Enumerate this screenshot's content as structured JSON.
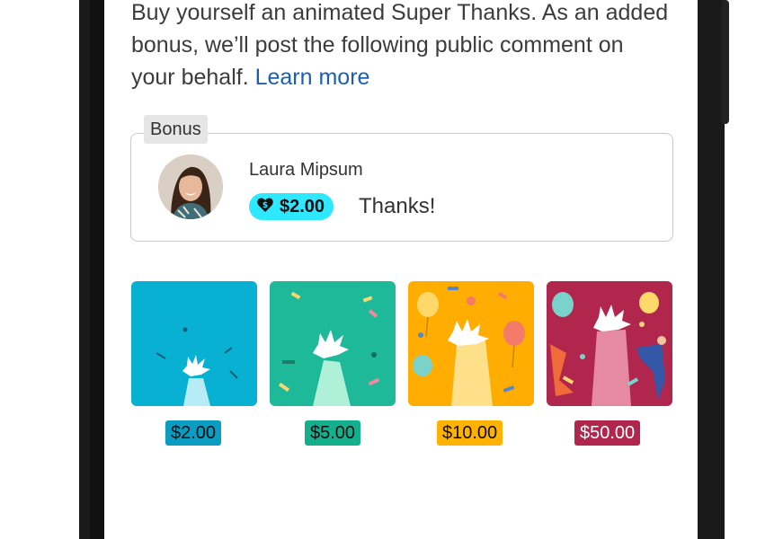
{
  "intro": {
    "text": "Buy yourself an animated Super Thanks. As an added bonus, we’ll post the following public comment on your behalf.",
    "link": "Learn more"
  },
  "bonus": {
    "tag": "Bonus",
    "user_name": "Laura Mipsum",
    "amount": "$2.00",
    "message": "Thanks!"
  },
  "options": [
    {
      "price": "$2.00",
      "color": "#08b0d2",
      "label_bg": "#0b9cc2",
      "label_fg": "#0f0f0f"
    },
    {
      "price": "$5.00",
      "color": "#1db998",
      "label_bg": "#14b08d",
      "label_fg": "#0f0f0f"
    },
    {
      "price": "$10.00",
      "color": "#ffad00",
      "label_bg": "#ffb300",
      "label_fg": "#0f0f0f"
    },
    {
      "price": "$50.00",
      "color": "#b0264d",
      "label_bg": "#b0264d",
      "label_fg": "#ffffff"
    }
  ],
  "icons": {
    "pill": "dollar-heart-icon"
  }
}
